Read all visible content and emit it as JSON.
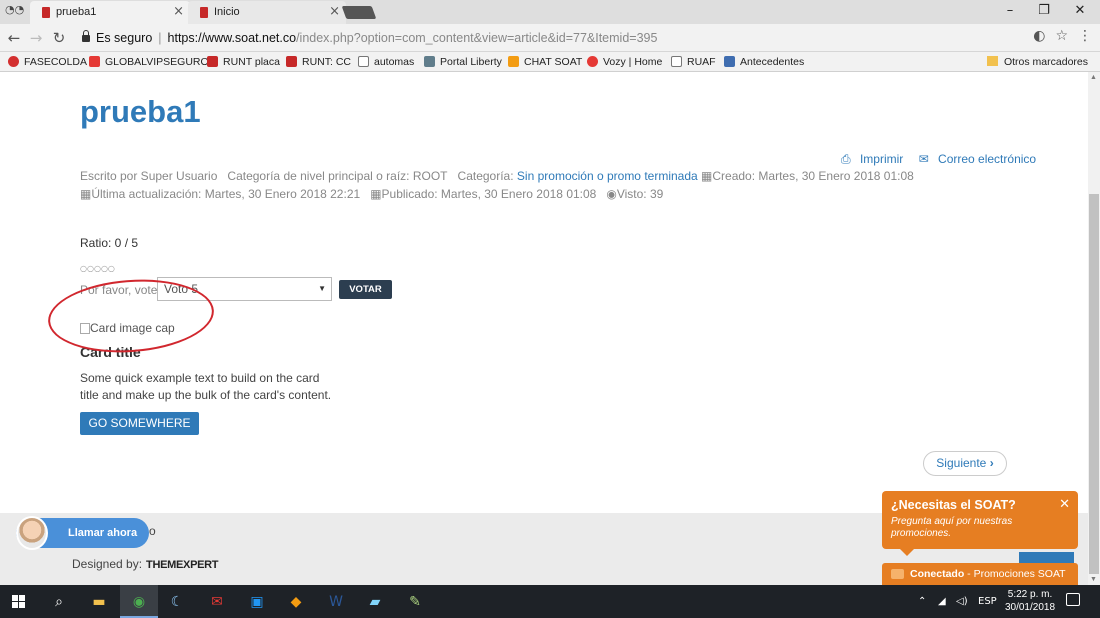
{
  "browser": {
    "tabs": [
      {
        "label": "prueba1",
        "active": true
      },
      {
        "label": "Inicio",
        "active": false
      }
    ],
    "tab_close_glyph": "×",
    "window_controls": {
      "minimize": "–",
      "restore": "❐",
      "close": "✕"
    },
    "address": {
      "secure_label": "Es seguro",
      "url_host": "https://www.soat.net.co",
      "url_rest": "/index.php?option=com_content&view=article&id=77&Itemid=395"
    },
    "bookmarks": [
      {
        "label": "FASECOLDA",
        "icon_color": "#d32f2f"
      },
      {
        "label": "GLOBALVIPSEGUROS",
        "icon_color": "#e53935"
      },
      {
        "label": "RUNT placa",
        "icon_color": "#c62828"
      },
      {
        "label": "RUNT: CC",
        "icon_color": "#c62828"
      },
      {
        "label": "automas",
        "icon_color": "#ffffff"
      },
      {
        "label": "Portal Liberty",
        "icon_color": "#607d8b"
      },
      {
        "label": "CHAT SOAT",
        "icon_color": "#f39c12"
      },
      {
        "label": "Vozy | Home",
        "icon_color": "#e53935"
      },
      {
        "label": "RUAF",
        "icon_color": "#ffffff"
      },
      {
        "label": "Antecedentes",
        "icon_color": "#3f6db0"
      }
    ],
    "other_bookmarks": "Otros marcadores"
  },
  "article": {
    "title": "prueba1",
    "actions": {
      "print": "Imprimir",
      "email": "Correo electrónico"
    },
    "meta_line1": {
      "author": "Escrito por Super Usuario",
      "parent_category": "Categoría de nivel principal o raíz: ROOT",
      "category_label": "Categoría:",
      "category_link": "Sin promoción o promo terminada",
      "created": "Creado: Martes, 30 Enero 2018 01:08"
    },
    "meta_line2": {
      "updated": "Última actualización: Martes, 30 Enero 2018 22:21",
      "published": "Publicado: Martes, 30 Enero 2018 01:08",
      "views": "Visto: 39"
    },
    "rating": {
      "ratio": "Ratio: 0 / 5",
      "stars": "○○○○○",
      "vote_label": "Por favor, vote",
      "vote_selected": "Voto 5",
      "vote_button": "VOTAR"
    },
    "card": {
      "image_alt": "Card image cap",
      "title": "Card title",
      "text": "Some quick example text to build on the card title and make up the bulk of the card's content.",
      "button": "GO SOMEWHERE"
    },
    "next_button": "Siguiente"
  },
  "footer": {
    "call_button": "Llamar ahora",
    "fragment": "o",
    "designed_by": "Designed by:",
    "brand": "THEMEXPERT"
  },
  "chat": {
    "title": "¿Necesitas el SOAT?",
    "subtitle": "Pregunta aquí por nuestras promociones.",
    "close": "✕",
    "status_bold": "Conectado",
    "status_rest": " - Promociones SOAT"
  },
  "taskbar": {
    "language": "ESP",
    "time": "5:22 p. m.",
    "date": "30/01/2018"
  },
  "colors": {
    "link_blue": "#2f7ab8",
    "chat_orange": "#e67e22",
    "annotation_red": "#d1272e"
  }
}
